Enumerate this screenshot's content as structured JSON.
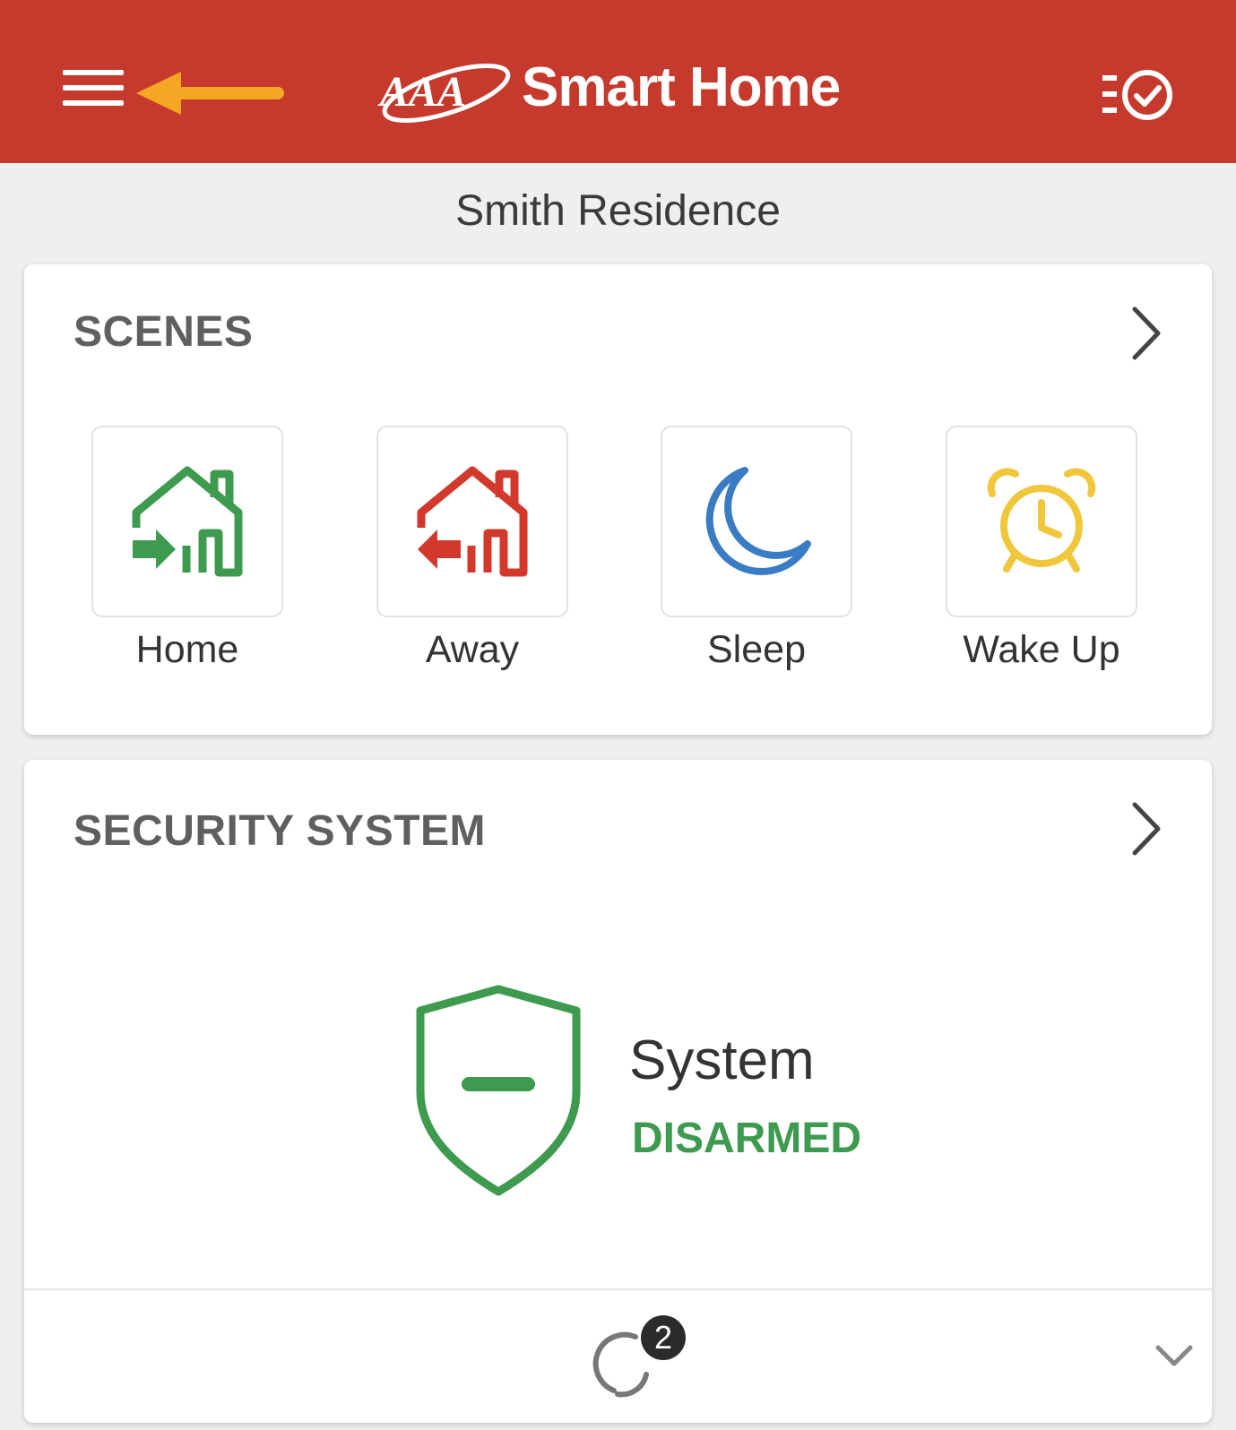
{
  "header": {
    "brand": "Smart Home",
    "logo_text": "AAA",
    "menu_icon": "hamburger-menu-icon",
    "tasks_icon": "checklist-icon",
    "bar_color": "#c53a2d",
    "arrow_color": "#f5a623"
  },
  "residence": "Smith Residence",
  "scenes": {
    "title": "SCENES",
    "items": [
      {
        "label": "Home",
        "icon": "house-arrive-icon",
        "color": "#3d9a4e"
      },
      {
        "label": "Away",
        "icon": "house-leave-icon",
        "color": "#d2382b"
      },
      {
        "label": "Sleep",
        "icon": "moon-icon",
        "color": "#3a7cc3"
      },
      {
        "label": "Wake Up",
        "icon": "alarm-clock-icon",
        "color": "#f0c63a"
      }
    ]
  },
  "security": {
    "title": "SECURITY SYSTEM",
    "system_label": "System",
    "status": "DISARMED",
    "status_color": "#3d9a4e",
    "icon": "shield-disarmed-icon",
    "sync_badge": "2"
  }
}
